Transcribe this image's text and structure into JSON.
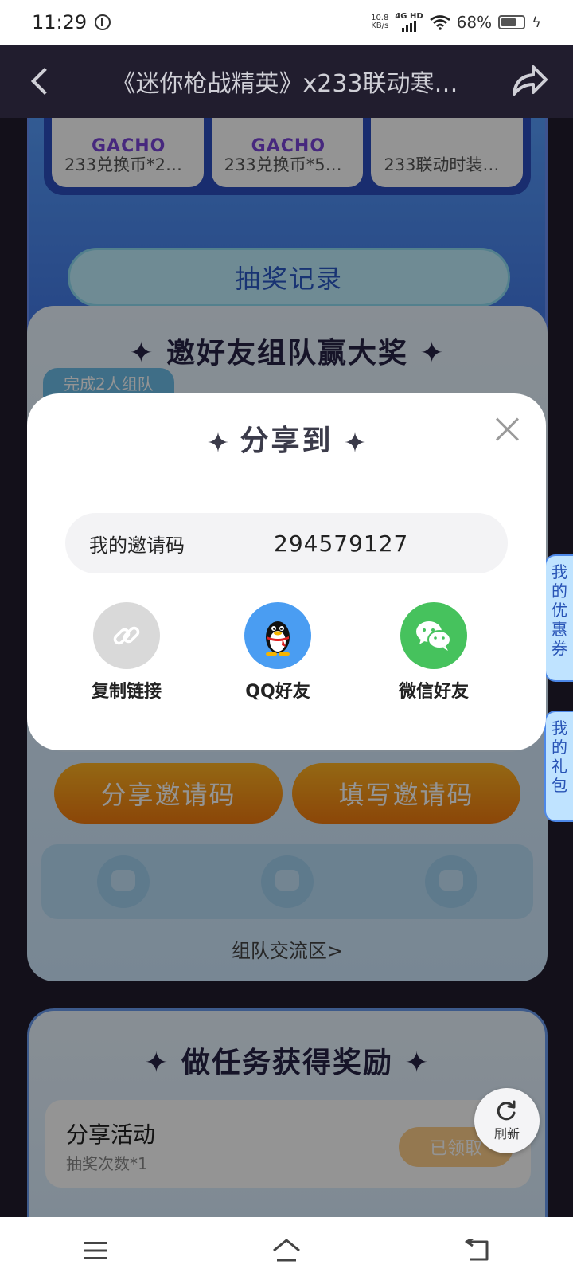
{
  "status_bar": {
    "time": "11:29",
    "net_speed_value": "10.8",
    "net_speed_unit": "KB/s",
    "network_type": "4G HD",
    "battery_percent": "68%"
  },
  "title_bar": {
    "title": "《迷你枪战精英》x233联动寒…"
  },
  "prize_panel": {
    "logo_text": "GACHO",
    "prizes": [
      "233兑换币*2…",
      "233兑换币*5…",
      "233联动时装…"
    ],
    "record_button": "抽奖记录"
  },
  "invite_panel": {
    "title": "邀好友组队赢大奖",
    "tag": "完成2人组队",
    "share_code_button": "分享邀请码",
    "fill_code_button": "填写邀请码",
    "team_link": "组队交流区>"
  },
  "task_panel": {
    "title": "做任务获得奖励",
    "task_name": "分享活动",
    "task_desc": "抽奖次数*1",
    "task_status": "已领取"
  },
  "side_tabs": {
    "coupon": "我的优惠券",
    "gift": "我的礼包"
  },
  "refresh": {
    "label": "刷新"
  },
  "dialog": {
    "title": "分享到",
    "invite_code_label": "我的邀请码",
    "invite_code": "294579127",
    "options": [
      {
        "label": "复制链接",
        "icon": "link-icon",
        "color": "#d9d9d9"
      },
      {
        "label": "QQ好友",
        "icon": "qq-penguin-icon",
        "color": "#4a9df2"
      },
      {
        "label": "微信好友",
        "icon": "wechat-icon",
        "color": "#46c25d"
      }
    ]
  },
  "colors": {
    "page_bg": "#211d2e",
    "dialog_bg": "#ffffff",
    "accent_blue": "#3d6ee0",
    "orange": "#f07a0f"
  }
}
